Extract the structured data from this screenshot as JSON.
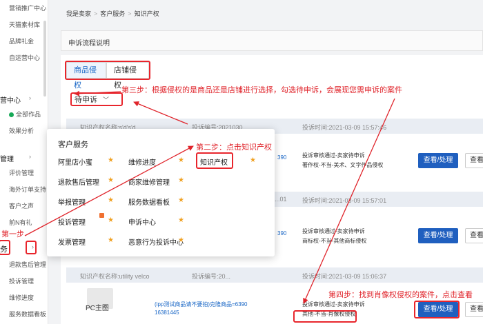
{
  "sidebar": {
    "items_top": [
      "营销推广中心",
      "天猫素材库",
      "品牌礼金",
      "自运营中心"
    ],
    "group_marketing": "营中心",
    "marketing_items": [
      "全部作品",
      "效果分析"
    ],
    "group_manage": "管理",
    "manage_items": [
      "评价管理",
      "海外订单支持",
      "客户之声",
      "前N有礼"
    ],
    "group_service": "务",
    "service_items": [
      "退款售后管理",
      "投诉管理",
      "维修进度",
      "服务数据看板"
    ]
  },
  "breadcrumb": [
    "我是卖家",
    "客户服务",
    "知识产权"
  ],
  "panel_title": "申诉流程说明",
  "tabs": [
    {
      "label": "商品侵权"
    },
    {
      "label": "店铺侵权"
    }
  ],
  "filter": {
    "label": "待申诉"
  },
  "rows": [
    {
      "name": "知识产权名称:s'd's'd",
      "id": "投诉编号:2021030...",
      "time": "投诉时间:2021-03-09 15:57:46",
      "status": "投诉审核通过-卖家待申诉",
      "reason": "著作权-不当-美术、文字作品侵权",
      "code": "390"
    },
    {
      "name": "",
      "id": "...01",
      "time": "投诉时间:2021-03-09 15:57:01",
      "status": "投诉审核通过-卖家待申诉",
      "reason": "商标权-不当-其他商标侵权",
      "code": "390"
    },
    {
      "name": "知识产权名称:utility velco",
      "id": "投诉编号:20...",
      "time": "投诉时间:2021-03-09 15:06:37",
      "status": "投诉审核通过-卖家待申诉",
      "reason": "其他-不当-肖像权侵权",
      "item_title": "PC主图",
      "product_link": "(ipp测试商品请不要拍)克隆商品=6390",
      "product_id": "16381445"
    }
  ],
  "buttons": {
    "handle": "查看/处理",
    "view": "查看"
  },
  "popup": {
    "title": "客户服务",
    "col1": [
      "阿里店小蜜",
      "退款售后管理",
      "举报管理",
      "投诉管理",
      "发票管理"
    ],
    "col2": [
      "维修进度",
      "商家维修管理",
      "服务数据看板",
      "申诉中心",
      "恶意行为投诉中心"
    ],
    "col3": [
      "知识产权"
    ]
  },
  "annotations": {
    "step1": "第一步",
    "step2": "第二步：点击知识产权",
    "step3": "第三步：根据侵权的是商品还是店铺进行选择，勾选待申诉，会展现您需申诉的案件",
    "step4": "第四步：找到肖像权侵权的案件，点击查看"
  },
  "colors": {
    "accent": "#1f5fbf",
    "annotation": "#e0242b",
    "star": "#f0a020",
    "sidebar_dot": "#17a957"
  }
}
